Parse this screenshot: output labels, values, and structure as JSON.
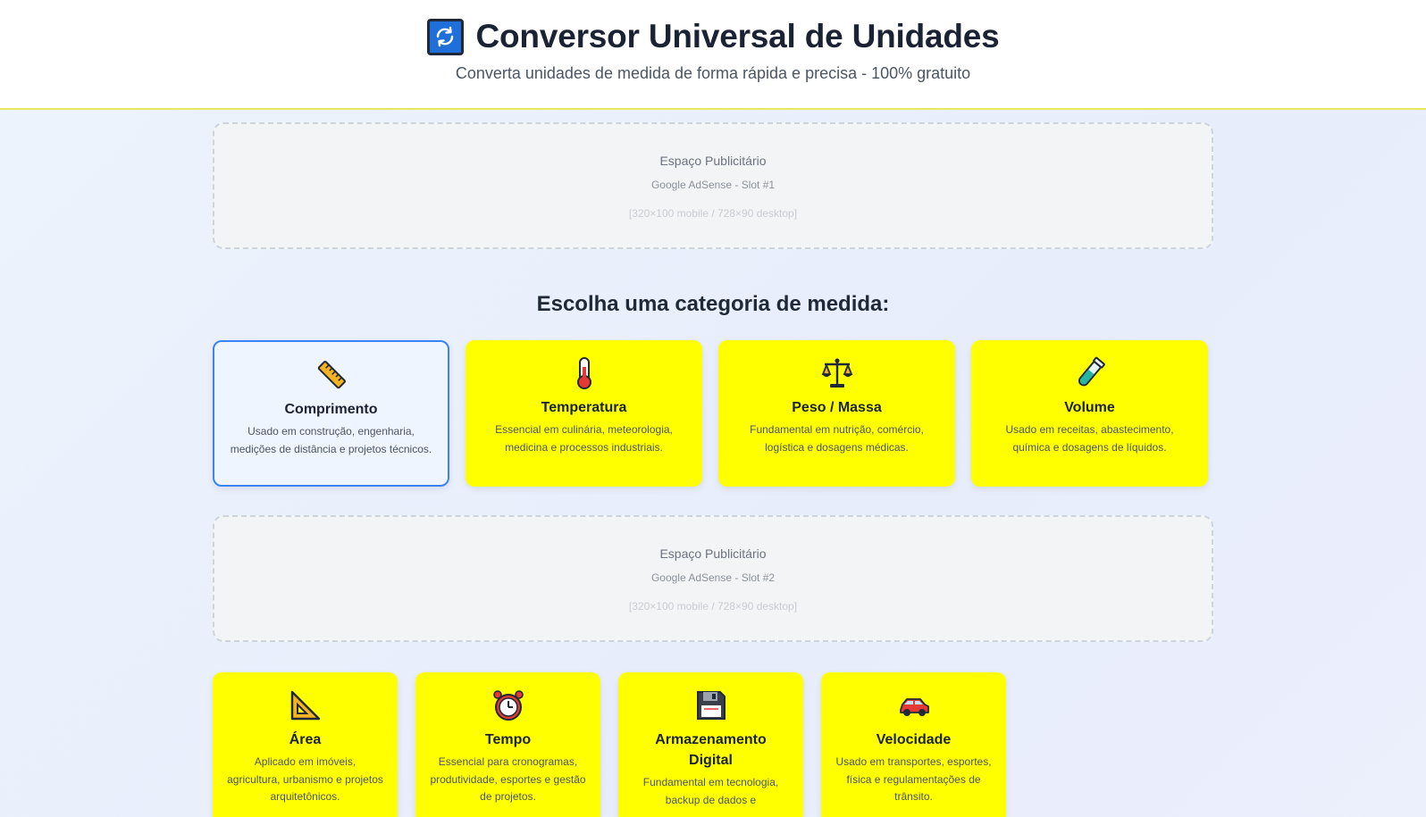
{
  "header": {
    "icon": "refresh-arrows-icon",
    "title": "Conversor Universal de Unidades",
    "subtitle": "Converta unidades de medida de forma rápida e precisa - 100% gratuito"
  },
  "ads": [
    {
      "title": "Espaço Publicitário",
      "slot": "Google AdSense - Slot #1",
      "size": "[320×100 mobile / 728×90 desktop]"
    },
    {
      "title": "Espaço Publicitário",
      "slot": "Google AdSense - Slot #2",
      "size": "[320×100 mobile / 728×90 desktop]"
    }
  ],
  "section_title": "Escolha uma categoria de medida:",
  "categories_row1": [
    {
      "icon": "ruler-icon",
      "title": "Comprimento",
      "desc": "Usado em construção, engenharia, medições de distância e projetos técnicos.",
      "active": true
    },
    {
      "icon": "thermometer-icon",
      "title": "Temperatura",
      "desc": "Essencial em culinária, meteorologia, medicina e processos industriais."
    },
    {
      "icon": "scale-icon",
      "title": "Peso / Massa",
      "desc": "Fundamental em nutrição, comércio, logística e dosagens médicas."
    },
    {
      "icon": "test-tube-icon",
      "title": "Volume",
      "desc": "Usado em receitas, abastecimento, química e dosagens de líquidos."
    }
  ],
  "categories_row2": [
    {
      "icon": "triangle-ruler-icon",
      "title": "Área",
      "desc": "Aplicado em imóveis, agricultura, urbanismo e projetos arquitetônicos."
    },
    {
      "icon": "alarm-clock-icon",
      "title": "Tempo",
      "desc": "Essencial para cronogramas, produtividade, esportes e gestão de projetos."
    },
    {
      "icon": "floppy-disk-icon",
      "title": "Armazenamento Digital",
      "desc": "Fundamental em tecnologia, backup de dados e"
    },
    {
      "icon": "car-icon",
      "title": "Velocidade",
      "desc": "Usado em transportes, esportes, física e regulamentações de trânsito."
    }
  ],
  "colors": {
    "card_bg": "#ffff00",
    "active_border": "#3b82f6",
    "logo_bg": "#1e6fd9"
  }
}
